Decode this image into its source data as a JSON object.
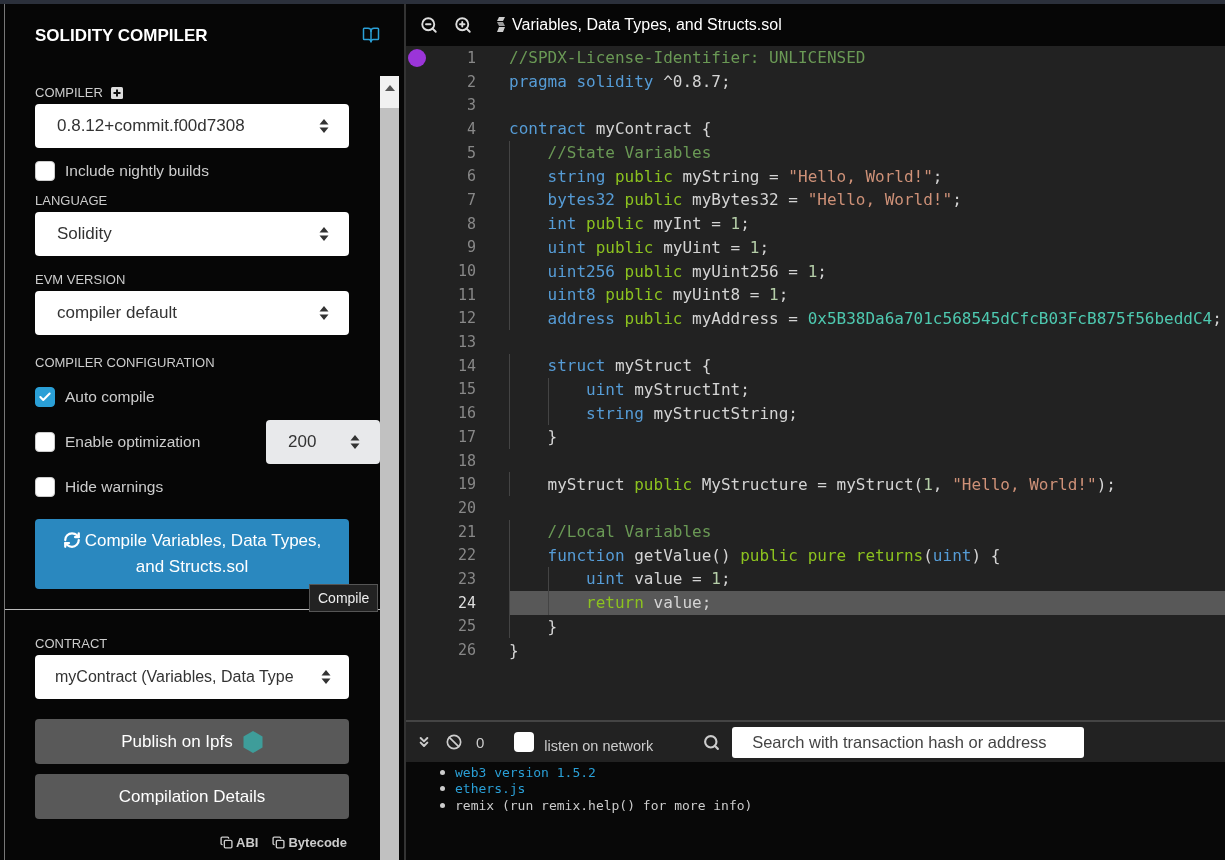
{
  "sidebar": {
    "title": "SOLIDITY COMPILER",
    "compiler": {
      "label": "COMPILER",
      "value": "0.8.12+commit.f00d7308"
    },
    "nightly": {
      "label": "Include nightly builds",
      "checked": false
    },
    "language": {
      "label": "LANGUAGE",
      "value": "Solidity"
    },
    "evm": {
      "label": "EVM VERSION",
      "value": "compiler default"
    },
    "config": {
      "label": "COMPILER CONFIGURATION",
      "options": [
        {
          "label": "Auto compile",
          "checked": true
        },
        {
          "label": "Enable optimization",
          "checked": false,
          "runs": "200"
        },
        {
          "label": "Hide warnings",
          "checked": false
        }
      ]
    },
    "compile_button": "Compile Variables, Data Types, and Structs.sol",
    "tooltip": "Compile",
    "contract": {
      "label": "CONTRACT",
      "value": "myContract (Variables, Data Type"
    },
    "buttons": [
      "Publish on Ipfs",
      "Compilation Details"
    ],
    "links": [
      "ABI",
      "Bytecode"
    ]
  },
  "editor": {
    "tab_title": "Variables, Data Types, and Structs.sol",
    "lines": [
      {
        "number": "1",
        "current": false,
        "marked": true,
        "tokens": [
          {
            "kind": "comment",
            "text": "//SPDX-License-Identifier: UNLICENSED"
          }
        ]
      },
      {
        "number": "2",
        "current": false,
        "marked": false,
        "tokens": [
          {
            "kind": "keyword",
            "text": "pragma solidity"
          },
          {
            "kind": "plain",
            "text": " ^0.8.7;"
          }
        ]
      },
      {
        "number": "3",
        "current": false,
        "marked": false
      },
      {
        "number": "4",
        "current": false,
        "marked": false,
        "tokens": [
          {
            "kind": "keyword",
            "text": "contract"
          },
          {
            "kind": "plain",
            "text": " myContract {"
          }
        ]
      },
      {
        "number": "5",
        "current": false,
        "marked": false,
        "tokens": [
          {
            "kind": "comment",
            "text": "    //State Variables"
          }
        ]
      },
      {
        "number": "6",
        "current": false,
        "marked": false,
        "tokens": [
          {
            "kind": "keyword",
            "text": "    string"
          },
          {
            "kind": "modifier",
            "text": " public"
          },
          {
            "kind": "plain",
            "text": " myString = "
          },
          {
            "kind": "string",
            "text": "\"Hello, World!\""
          },
          {
            "kind": "plain",
            "text": ";"
          }
        ]
      },
      {
        "number": "7",
        "current": false,
        "marked": false,
        "tokens": [
          {
            "kind": "keyword",
            "text": "    bytes32"
          },
          {
            "kind": "modifier",
            "text": " public"
          },
          {
            "kind": "plain",
            "text": " myBytes32 = "
          },
          {
            "kind": "string",
            "text": "\"Hello, World!\""
          },
          {
            "kind": "plain",
            "text": ";"
          }
        ]
      },
      {
        "number": "8",
        "current": false,
        "marked": false,
        "tokens": [
          {
            "kind": "keyword",
            "text": "    int"
          },
          {
            "kind": "modifier",
            "text": " public"
          },
          {
            "kind": "plain",
            "text": " myInt = "
          },
          {
            "kind": "number",
            "text": "1"
          },
          {
            "kind": "plain",
            "text": ";"
          }
        ]
      },
      {
        "number": "9",
        "current": false,
        "marked": false,
        "tokens": [
          {
            "kind": "keyword",
            "text": "    uint"
          },
          {
            "kind": "modifier",
            "text": " public"
          },
          {
            "kind": "plain",
            "text": " myUint = "
          },
          {
            "kind": "number",
            "text": "1"
          },
          {
            "kind": "plain",
            "text": ";"
          }
        ]
      },
      {
        "number": "10",
        "current": false,
        "marked": false,
        "tokens": [
          {
            "kind": "keyword",
            "text": "    uint256"
          },
          {
            "kind": "modifier",
            "text": " public"
          },
          {
            "kind": "plain",
            "text": " myUint256 = "
          },
          {
            "kind": "number",
            "text": "1"
          },
          {
            "kind": "plain",
            "text": ";"
          }
        ]
      },
      {
        "number": "11",
        "current": false,
        "marked": false,
        "tokens": [
          {
            "kind": "keyword",
            "text": "    uint8"
          },
          {
            "kind": "modifier",
            "text": " public"
          },
          {
            "kind": "plain",
            "text": " myUint8 = "
          },
          {
            "kind": "number",
            "text": "1"
          },
          {
            "kind": "plain",
            "text": ";"
          }
        ]
      },
      {
        "number": "12",
        "current": false,
        "marked": false,
        "tokens": [
          {
            "kind": "keyword",
            "text": "    address"
          },
          {
            "kind": "modifier",
            "text": " public"
          },
          {
            "kind": "plain",
            "text": " myAddress = "
          },
          {
            "kind": "hex",
            "text": "0x5B38Da6a701c568545dCfcB03FcB875f56beddC4"
          },
          {
            "kind": "plain",
            "text": ";"
          }
        ]
      },
      {
        "number": "13",
        "current": false,
        "marked": false
      },
      {
        "number": "14",
        "current": false,
        "marked": false,
        "tokens": [
          {
            "kind": "keyword",
            "text": "    struct"
          },
          {
            "kind": "plain",
            "text": " myStruct {"
          }
        ]
      },
      {
        "number": "15",
        "current": false,
        "marked": false,
        "tokens": [
          {
            "kind": "keyword",
            "text": "        uint"
          },
          {
            "kind": "plain",
            "text": " myStructInt;"
          }
        ]
      },
      {
        "number": "16",
        "current": false,
        "marked": false,
        "tokens": [
          {
            "kind": "keyword",
            "text": "        string"
          },
          {
            "kind": "plain",
            "text": " myStructString;"
          }
        ]
      },
      {
        "number": "17",
        "current": false,
        "marked": false,
        "tokens": [
          {
            "kind": "plain",
            "text": "    }"
          }
        ]
      },
      {
        "number": "18",
        "current": false,
        "marked": false
      },
      {
        "number": "19",
        "current": false,
        "marked": false,
        "tokens": [
          {
            "kind": "plain",
            "text": "    myStruct"
          },
          {
            "kind": "modifier",
            "text": " public"
          },
          {
            "kind": "plain",
            "text": " MyStructure = myStruct("
          },
          {
            "kind": "number",
            "text": "1"
          },
          {
            "kind": "plain",
            "text": ", "
          },
          {
            "kind": "string",
            "text": "\"Hello, World!\""
          },
          {
            "kind": "plain",
            "text": ");"
          }
        ]
      },
      {
        "number": "20",
        "current": false,
        "marked": false
      },
      {
        "number": "21",
        "current": false,
        "marked": false,
        "tokens": [
          {
            "kind": "comment",
            "text": "    //Local Variables"
          }
        ]
      },
      {
        "number": "22",
        "current": false,
        "marked": false,
        "tokens": [
          {
            "kind": "keyword",
            "text": "    function"
          },
          {
            "kind": "plain",
            "text": " getValue()"
          },
          {
            "kind": "modifier",
            "text": " public pure returns"
          },
          {
            "kind": "plain",
            "text": "("
          },
          {
            "kind": "keyword",
            "text": "uint"
          },
          {
            "kind": "plain",
            "text": ") {"
          }
        ]
      },
      {
        "number": "23",
        "current": false,
        "marked": false,
        "tokens": [
          {
            "kind": "keyword",
            "text": "        uint"
          },
          {
            "kind": "plain",
            "text": " value = "
          },
          {
            "kind": "number",
            "text": "1"
          },
          {
            "kind": "plain",
            "text": ";"
          }
        ]
      },
      {
        "number": "24",
        "current": true,
        "marked": false,
        "tokens": [
          {
            "kind": "modifier",
            "text": "        return"
          },
          {
            "kind": "plain",
            "text": " value;"
          }
        ]
      },
      {
        "number": "25",
        "current": false,
        "marked": false,
        "tokens": [
          {
            "kind": "plain",
            "text": "    }"
          }
        ]
      },
      {
        "number": "26",
        "current": false,
        "marked": false,
        "tokens": [
          {
            "kind": "plain",
            "text": "}"
          }
        ]
      }
    ]
  },
  "terminal": {
    "count": "0",
    "listen": {
      "label": "listen on network",
      "checked": false
    },
    "search": {
      "placeholder": "Search with transaction hash or address"
    },
    "log": [
      {
        "kind": "link",
        "text": "web3 version 1.5.2"
      },
      {
        "kind": "link",
        "text": "ethers.js"
      },
      {
        "kind": "plain",
        "text": "remix (run remix.help() for more info)"
      }
    ]
  }
}
